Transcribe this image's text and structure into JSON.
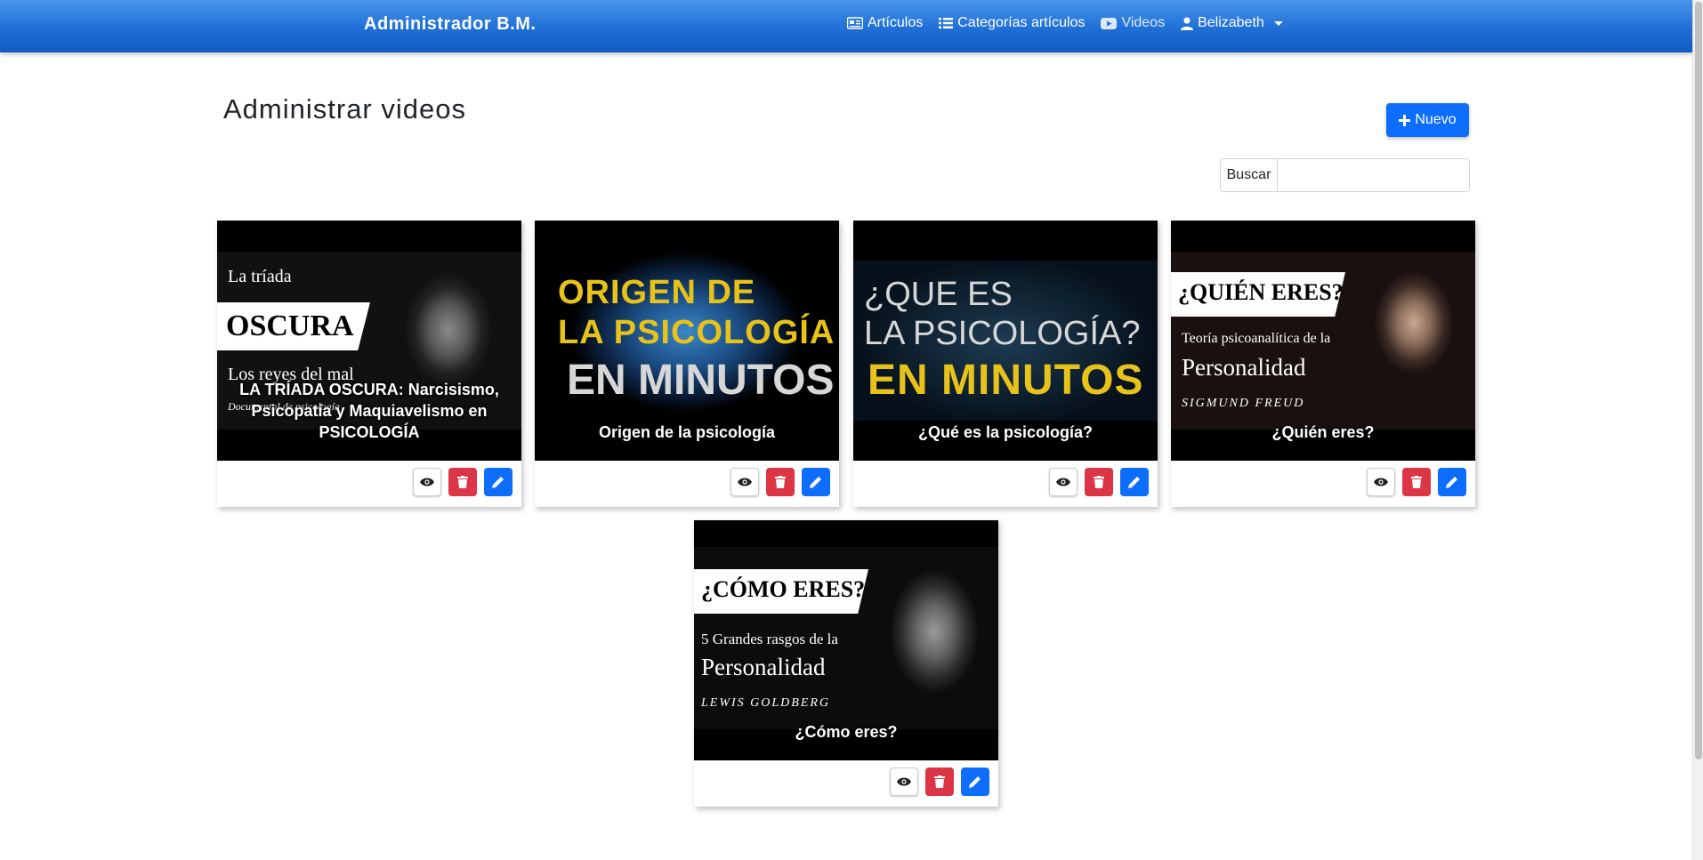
{
  "navbar": {
    "brand": "Administrador B.M.",
    "items": [
      {
        "label": "Artículos",
        "icon": "newspaper-icon"
      },
      {
        "label": "Categorías artículos",
        "icon": "list-icon"
      },
      {
        "label": "Videos",
        "icon": "youtube-icon",
        "active": true
      },
      {
        "label": "Belizabeth",
        "icon": "user-icon"
      }
    ]
  },
  "page": {
    "title": "Administrar videos",
    "new_button": "Nuevo",
    "search_label": "Buscar",
    "search_value": ""
  },
  "videos": [
    {
      "title": "LA TRÍADA OSCURA: Narcisismo, Psicopatía y Maquiavelismo en PSICOLOGÍA",
      "thumb": {
        "line1": "La tríada",
        "line2": "OSCURA",
        "line3": "Los reyes del mal",
        "line4": "Documental de psicología"
      }
    },
    {
      "title": "Origen de la psicología",
      "thumb": {
        "line1": "ORIGEN DE",
        "line2": "LA PSICOLOGÍA",
        "line3": "EN MINUTOS"
      }
    },
    {
      "title": "¿Qué es la psicología?",
      "thumb": {
        "line1": "¿QUE ES",
        "line2": "LA PSICOLOGÍA?",
        "line3": "EN MINUTOS"
      }
    },
    {
      "title": "¿Quién eres?",
      "thumb": {
        "line1": "¿QUIÉN ERES?",
        "line2": "Teoría psicoanalítica de la",
        "line3": "Personalidad",
        "line4": "SIGMUND FREUD"
      }
    },
    {
      "title": "¿Cómo eres?",
      "thumb": {
        "line1": "¿CÓMO ERES?",
        "line2": "5 Grandes rasgos de la",
        "line3": "Personalidad",
        "line4": "LEWIS GOLDBERG"
      }
    }
  ],
  "colors": {
    "primary": "#0d6efd",
    "danger": "#dc3545",
    "navbar": "#1f6fd6"
  }
}
